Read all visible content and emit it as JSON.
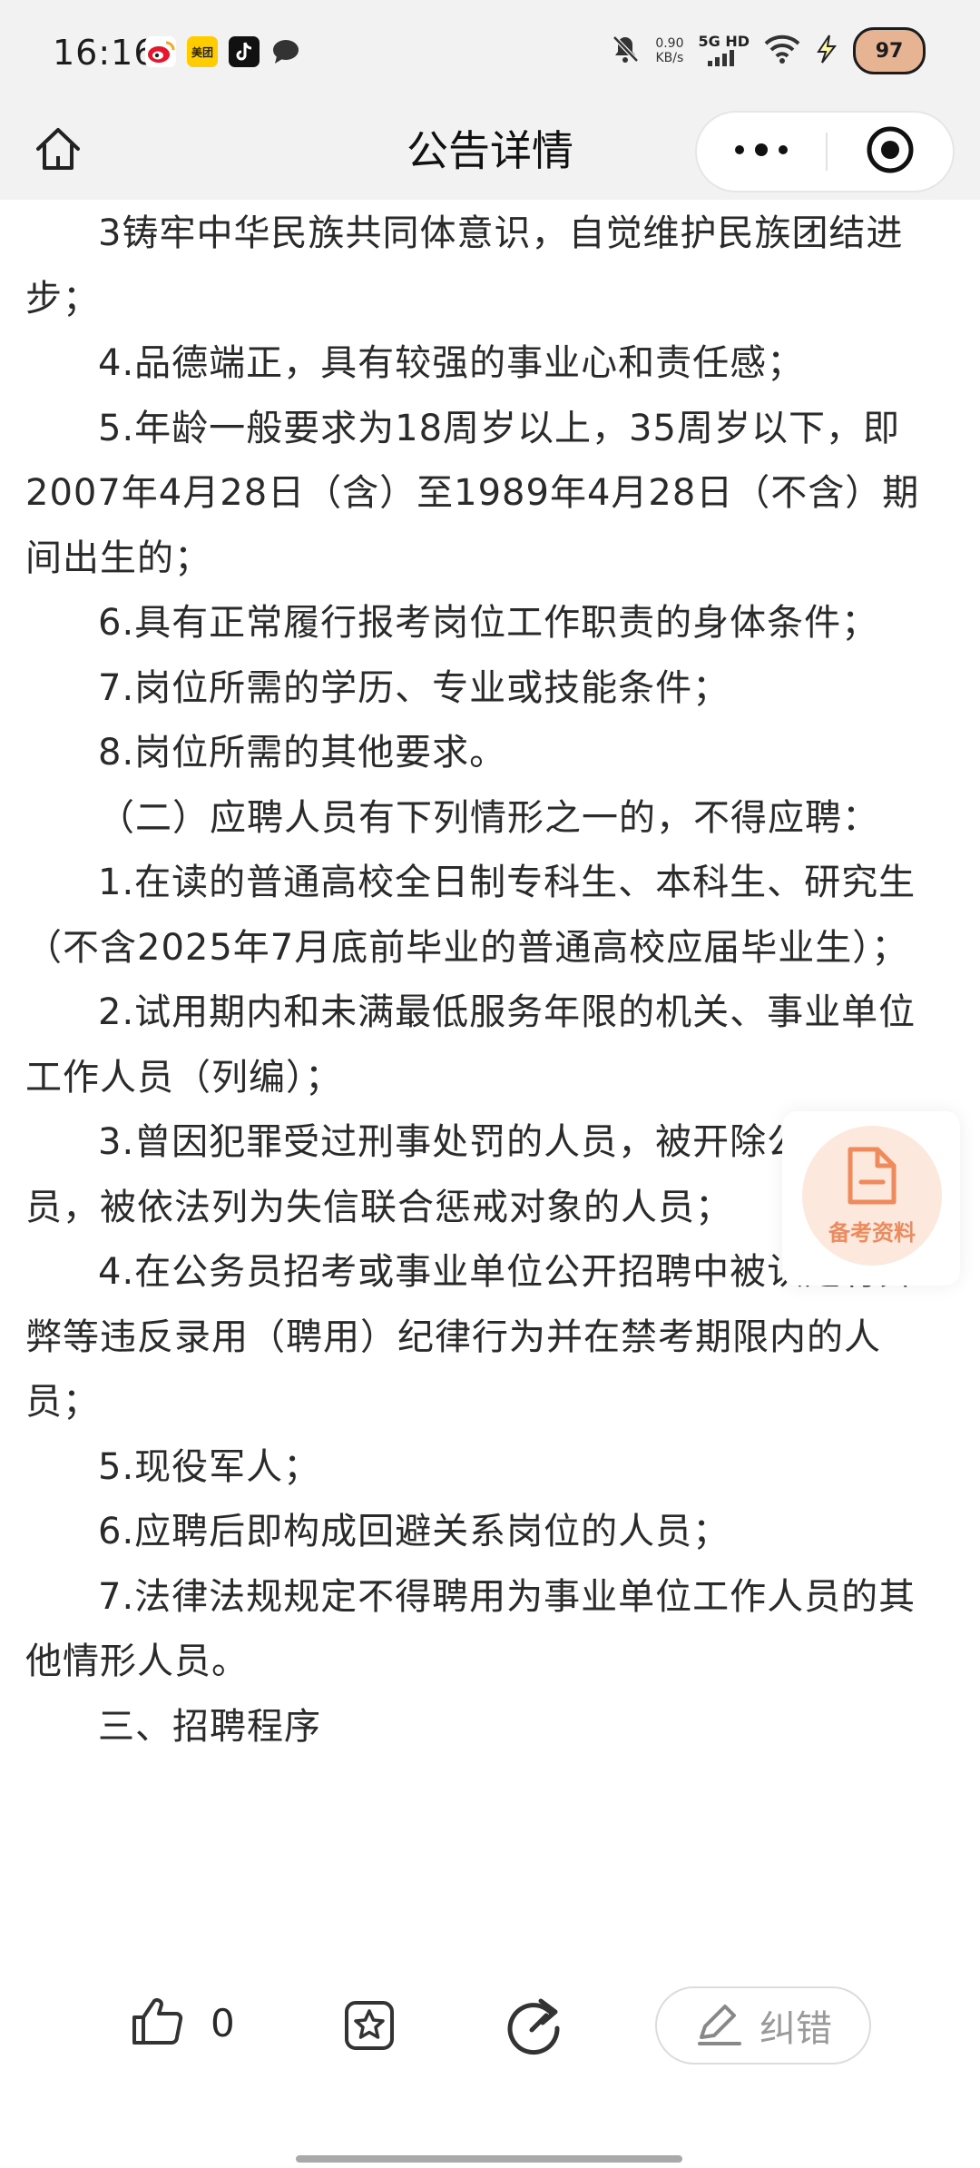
{
  "status_bar": {
    "time": "16:16",
    "app_icons": [
      {
        "name": "weibo-icon",
        "label": "",
        "color": "#f5b300"
      },
      {
        "name": "meituan-icon",
        "label": "美团",
        "color": "#ffcc00"
      },
      {
        "name": "tiktok-icon",
        "label": "",
        "color": "#111111"
      },
      {
        "name": "message-icon",
        "label": "",
        "color": "#333333"
      }
    ],
    "net_speed_value": "0.90",
    "net_speed_unit": "KB/s",
    "network_label": "5G HD",
    "battery": "97"
  },
  "header": {
    "title": "公告详情"
  },
  "content": {
    "paragraphs": [
      "3铸牢中华民族共同体意识，自觉维护民族团结进步；",
      "4.品德端正，具有较强的事业心和责任感；",
      "5.年龄一般要求为18周岁以上，35周岁以下，即2007年4月28日（含）至1989年4月28日（不含）期间出生的；",
      "6.具有正常履行报考岗位工作职责的身体条件；",
      "7.岗位所需的学历、专业或技能条件；",
      "8.岗位所需的其他要求。",
      "（二）应聘人员有下列情形之一的，不得应聘：",
      "1.在读的普通高校全日制专科生、本科生、研究生（不含2025年7月底前毕业的普通高校应届毕业生）；",
      "2.试用期内和未满最低服务年限的机关、事业单位工作人员（列编）；",
      "3.曾因犯罪受过刑事处罚的人员，被开除公职的人员，被依法列为失信联合惩戒对象的人员；",
      "4.在公务员招考或事业单位公开招聘中被认定有舞弊等违反录用（聘用）纪律行为并在禁考期限内的人员；",
      "5.现役军人；",
      "6.应聘后即构成回避关系岗位的人员；",
      "7.法律法规规定不得聘用为事业单位工作人员的其他情形人员。",
      "三、招聘程序"
    ]
  },
  "float_widget": {
    "label": "备考资料"
  },
  "bottom_bar": {
    "like_count": "0",
    "correct_label": "纠错"
  },
  "colors": {
    "bar_background": "#f2f2f2",
    "accent_orange": "#ef8a5c",
    "text": "#2a2a2a"
  }
}
